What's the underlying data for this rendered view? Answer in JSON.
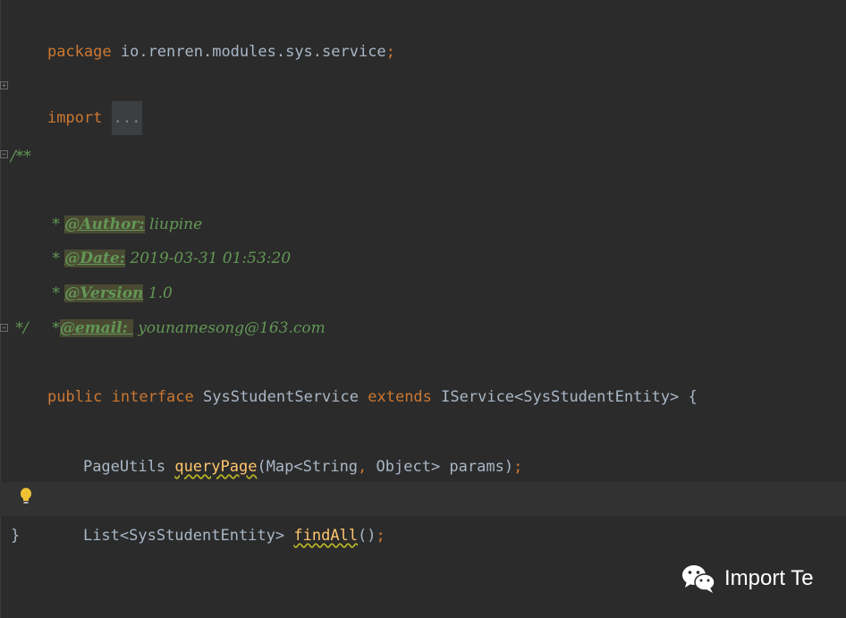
{
  "code": {
    "package": {
      "keyword": "package",
      "name": "io.renren.modules.sys.service",
      "semicolon": ";"
    },
    "import": {
      "keyword": "import",
      "folded": "..."
    },
    "javadoc": {
      "open": "/**",
      "author_star": " * ",
      "author_tag": "@Author:",
      "author_value": " liupine",
      "date_star": " * ",
      "date_tag": "@Date:",
      "date_value": " 2019-03-31 01:53:20",
      "version_star": " * ",
      "version_tag": "@Version",
      "version_value": " 1.0",
      "email_star": " *",
      "email_tag": "@email: ",
      "email_value": " younamesong@163.com",
      "close": " */"
    },
    "interface_decl": {
      "kw_public": "public",
      "kw_interface": "interface",
      "name": "SysStudentService",
      "kw_extends": "extends",
      "parent": "IService<SysStudentEntity>",
      "brace": " {"
    },
    "method1": {
      "return_type": "PageUtils",
      "name": "queryPage",
      "params_open": "(Map<String",
      "comma": ",",
      "params_rest": " Object> params)",
      "semicolon": ";"
    },
    "method2": {
      "return_type": "List<SysStudentEntity>",
      "name": "findAll",
      "params": "()",
      "semicolon": ";"
    },
    "closing_brace": "}"
  },
  "watermark": {
    "icon": "wechat-icon",
    "text": "Import Te"
  },
  "colors": {
    "background": "#2b2b2b",
    "keyword": "#cc7832",
    "comment": "#629755",
    "method": "#ffc66d",
    "text": "#a9b7c6"
  }
}
